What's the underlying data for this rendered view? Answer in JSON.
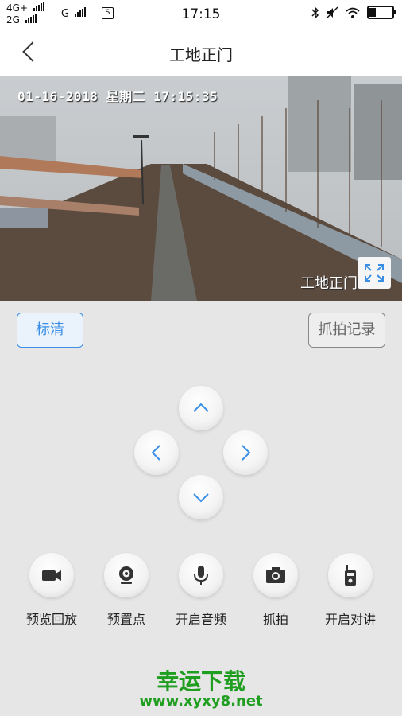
{
  "status_bar": {
    "network_top": "4G+",
    "network_bottom": "2G",
    "network_g": "G",
    "time": "17:15"
  },
  "nav": {
    "title": "工地正门"
  },
  "video": {
    "osd_timestamp": "01-16-2018 星期二 17:15:35",
    "osd_channel": "工地正门"
  },
  "controls": {
    "quality_label": "标清",
    "records_label": "抓拍记录"
  },
  "functions": [
    {
      "label": "预览回放",
      "icon": "video-camera-icon"
    },
    {
      "label": "预置点",
      "icon": "webcam-icon"
    },
    {
      "label": "开启音频",
      "icon": "microphone-icon"
    },
    {
      "label": "抓拍",
      "icon": "camera-icon"
    },
    {
      "label": "开启对讲",
      "icon": "walkie-talkie-icon"
    }
  ],
  "watermark": {
    "title": "幸运下载",
    "url": "www.xyxy8.net"
  },
  "colors": {
    "accent": "#3a8ee6",
    "background": "#e6e6e6",
    "watermark": "#1f9e1f"
  }
}
